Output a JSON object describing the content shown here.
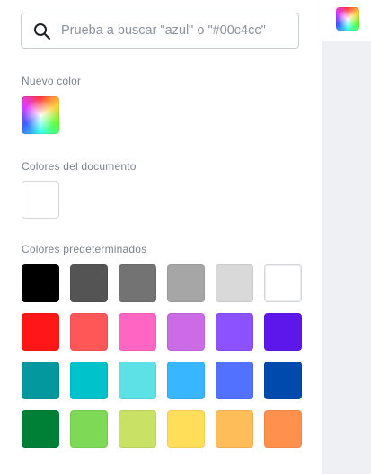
{
  "search": {
    "placeholder": "Prueba a buscar \"azul\" o \"#00c4cc\""
  },
  "sections": {
    "new_color": "Nuevo color",
    "document_colors": "Colores del documento",
    "default_colors": "Colores predeterminados"
  },
  "document_colors": [
    "#ffffff"
  ],
  "default_colors": [
    [
      "#000000",
      "#545454",
      "#737373",
      "#a6a6a6",
      "#d9d9d9",
      "#ffffff"
    ],
    [
      "#ff1616",
      "#ff5757",
      "#ff66c4",
      "#cb6ce6",
      "#8c52ff",
      "#5e17eb"
    ],
    [
      "#03989e",
      "#00c2cb",
      "#5ce1e6",
      "#38b6ff",
      "#5271ff",
      "#004aad"
    ],
    [
      "#008037",
      "#7ed957",
      "#c9e265",
      "#ffde59",
      "#ffbd59",
      "#ff914d"
    ]
  ],
  "icons": {
    "search": "search-icon",
    "new_color": "color-spectrum-icon",
    "rail_tab": "color-spectrum-icon"
  }
}
